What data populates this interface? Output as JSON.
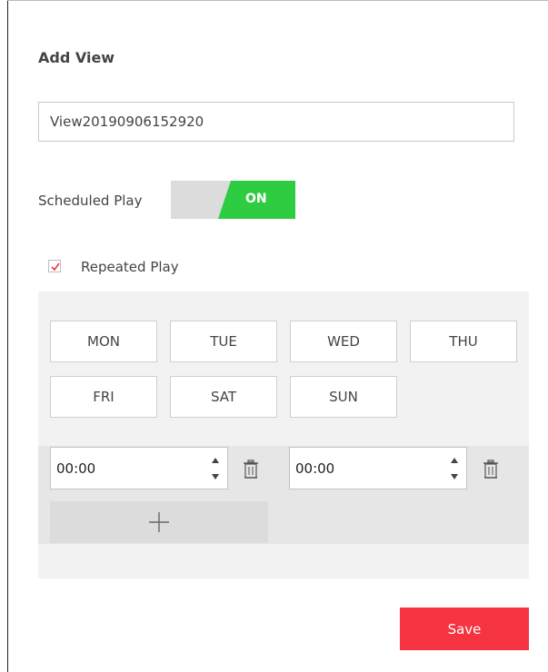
{
  "dialog": {
    "title": "Add View",
    "view_name_value": "View20190906152920"
  },
  "scheduled_play": {
    "label": "Scheduled Play",
    "toggle_state": "ON",
    "toggle_color": "#2ecc40"
  },
  "repeated_play": {
    "label": "Repeated Play",
    "checked": true,
    "check_color": "#f53341"
  },
  "days": [
    "MON",
    "TUE",
    "WED",
    "THU",
    "FRI",
    "SAT",
    "SUN"
  ],
  "time_slot": {
    "start": "00:00",
    "end": "00:00"
  },
  "icons": {
    "spinner": "spinner-up-down-icon",
    "delete": "trash-icon",
    "add": "plus-icon"
  },
  "actions": {
    "save_label": "Save",
    "save_color": "#f53341"
  }
}
